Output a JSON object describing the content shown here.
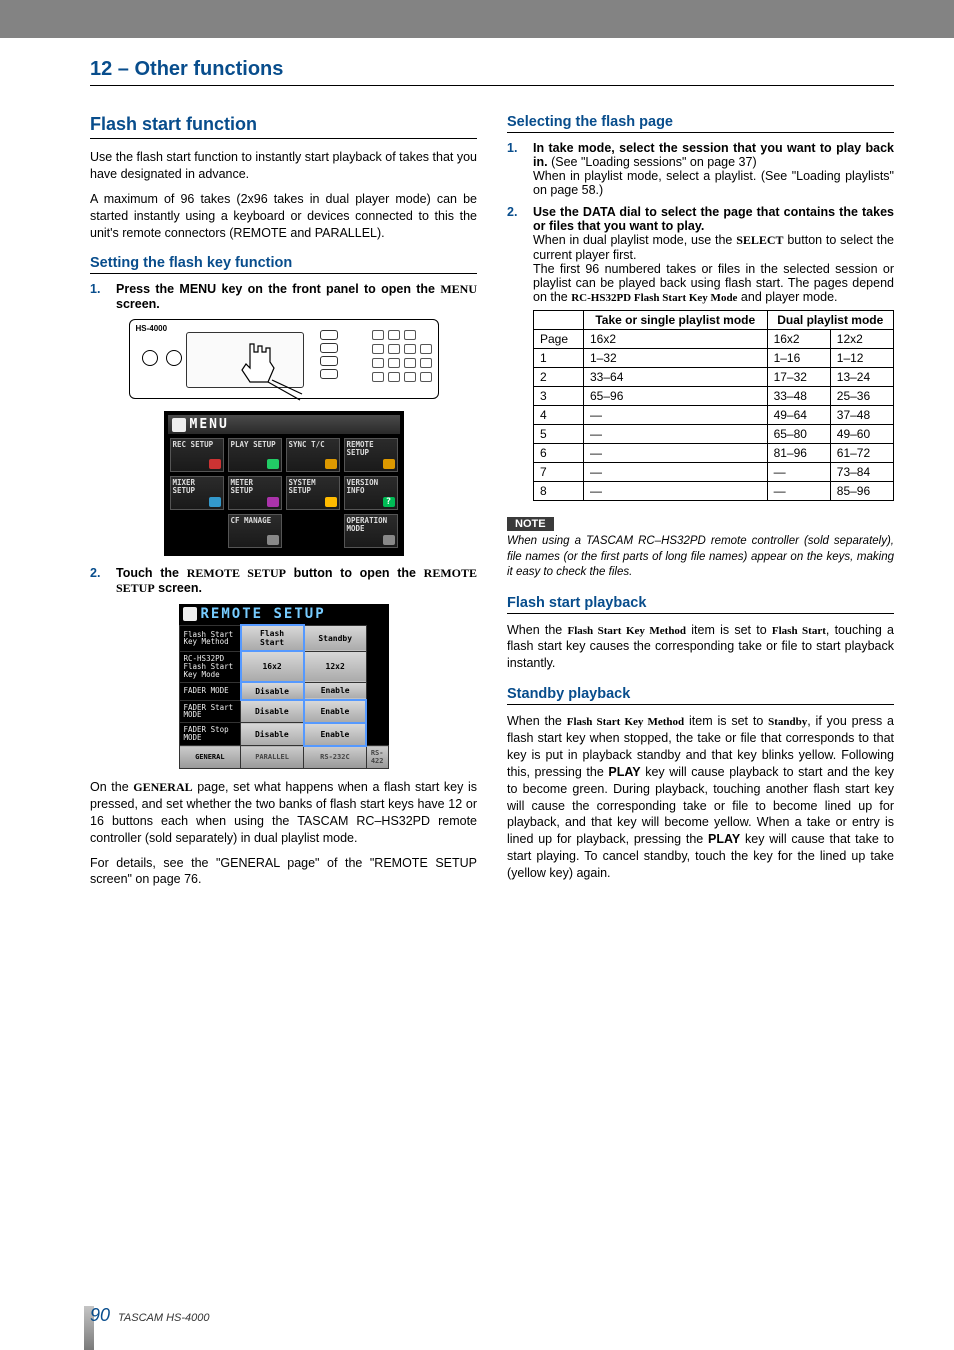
{
  "chapter": "12 – Other functions",
  "footer": {
    "page": "90",
    "product": "TASCAM HS-4000"
  },
  "left": {
    "section": "Flash start function",
    "intro1": "Use the flash start function to instantly start playback of takes that you have designated in advance.",
    "intro2": "A maximum of 96 takes (2x96 takes in dual player mode) can be started instantly using a keyboard or devices connected to this the unit's remote connectors (REMOTE and PARALLEL).",
    "sub1": "Setting the flash key function",
    "step1_a": "Press the MENU key on the front panel to open the ",
    "step1_b": "MENU",
    "step1_c": " screen.",
    "device_label": "HS-4000",
    "menu_title": "MENU",
    "menu_cells": [
      "REC SETUP",
      "PLAY SETUP",
      "SYNC T/C",
      "REMOTE SETUP",
      "MIXER SETUP",
      "METER SETUP",
      "SYSTEM SETUP",
      "VERSION INFO",
      "",
      "CF MANAGE",
      "",
      "OPERATION MODE"
    ],
    "step2_a": "Touch the ",
    "step2_b": "REMOTE SETUP",
    "step2_c": " button to open the ",
    "step2_d": "REMOTE SETUP",
    "step2_e": " screen.",
    "remote_title": "REMOTE SETUP",
    "remote_rows": [
      {
        "label": "Flash Start Key Method",
        "a": "Flash Start",
        "b": "Standby",
        "sel": "a"
      },
      {
        "label": "RC-HS32PD Flash Start Key Mode",
        "a": "16x2",
        "b": "12x2",
        "sel": "a"
      },
      {
        "label": "FADER MODE",
        "a": "Disable",
        "b": "Enable",
        "sel": "a"
      },
      {
        "label": "FADER Start MODE",
        "a": "Disable",
        "b": "Enable",
        "sel": "b"
      },
      {
        "label": "FADER Stop MODE",
        "a": "Disable",
        "b": "Enable",
        "sel": "b"
      }
    ],
    "remote_tabs": [
      "GENERAL",
      "PARALLEL",
      "RS-232C",
      "RS-422"
    ],
    "para_a": "On the ",
    "para_b": "GENERAL",
    "para_c": " page, set what happens when a flash start key is pressed, and set whether the two banks of flash start keys have 12 or 16 buttons each when using the TASCAM RC–HS32PD remote controller (sold separately) in dual playlist mode.",
    "para2": "For details, see the \"GENERAL page\" of the \"REMOTE SETUP screen\" on page 76."
  },
  "right": {
    "sub1": "Selecting the flash page",
    "s1_a": "In take mode, select the session that you want to play back in.",
    "s1_b": " (See \"Loading sessions\" on page 37)",
    "s1_c": "When in playlist mode, select a playlist. (See \"Loading playlists\" on page 58.)",
    "s2_a": "Use the DATA dial to select the page that contains the takes or files that you want to play.",
    "s2_b1": "When in dual playlist mode, use the ",
    "s2_b2": "SELECT",
    "s2_b3": " button to select the current player first.",
    "s2_c": "The first 96 numbered takes or files in the selected session or playlist can be played back using flash start. The pages depend on the ",
    "s2_d": "RC-HS32PD Flash Start Key Mode",
    "s2_e": " and player mode.",
    "table": {
      "h1": "Take or single playlist mode",
      "h2": "Dual playlist mode",
      "rows": [
        [
          "Page",
          "16x2",
          "16x2",
          "12x2"
        ],
        [
          "1",
          "1–32",
          "1–16",
          "1–12"
        ],
        [
          "2",
          "33–64",
          "17–32",
          "13–24"
        ],
        [
          "3",
          "65–96",
          "33–48",
          "25–36"
        ],
        [
          "4",
          "—",
          "49–64",
          "37–48"
        ],
        [
          "5",
          "—",
          "65–80",
          "49–60"
        ],
        [
          "6",
          "—",
          "81–96",
          "61–72"
        ],
        [
          "7",
          "—",
          "—",
          "73–84"
        ],
        [
          "8",
          "—",
          "—",
          "85–96"
        ]
      ]
    },
    "note_label": "NOTE",
    "note": "When using a TASCAM RC–HS32PD remote controller (sold separately), file names (or the first parts of long file names) appear on the keys, making it easy to check the files.",
    "sub2": "Flash start playback",
    "fs_a": "When the ",
    "fs_b": "Flash Start Key Method",
    "fs_c": " item is set to ",
    "fs_d": "Flash Start",
    "fs_e": ", touching a flash start key causes the corresponding take or file to start playback instantly.",
    "sub3": "Standby playback",
    "sb_a": "When the ",
    "sb_b": "Flash Start Key Method",
    "sb_c": " item is set to ",
    "sb_d": "Standby",
    "sb_e": ", if you press a flash start key when stopped, the take or file that corresponds to that key is put in playback standby and that key blinks yellow. Following this, pressing the ",
    "sb_f": "PLAY",
    "sb_g": " key will cause playback to start and the key to become green. During playback, touching another flash start key will cause the corresponding take or file to become lined up for playback, and that key will become yellow. When a take or entry is lined up for playback, pressing the ",
    "sb_h": "PLAY",
    "sb_i": " key will cause that take to start playing. To cancel standby, touch the key for the lined up take (yellow key) again."
  }
}
